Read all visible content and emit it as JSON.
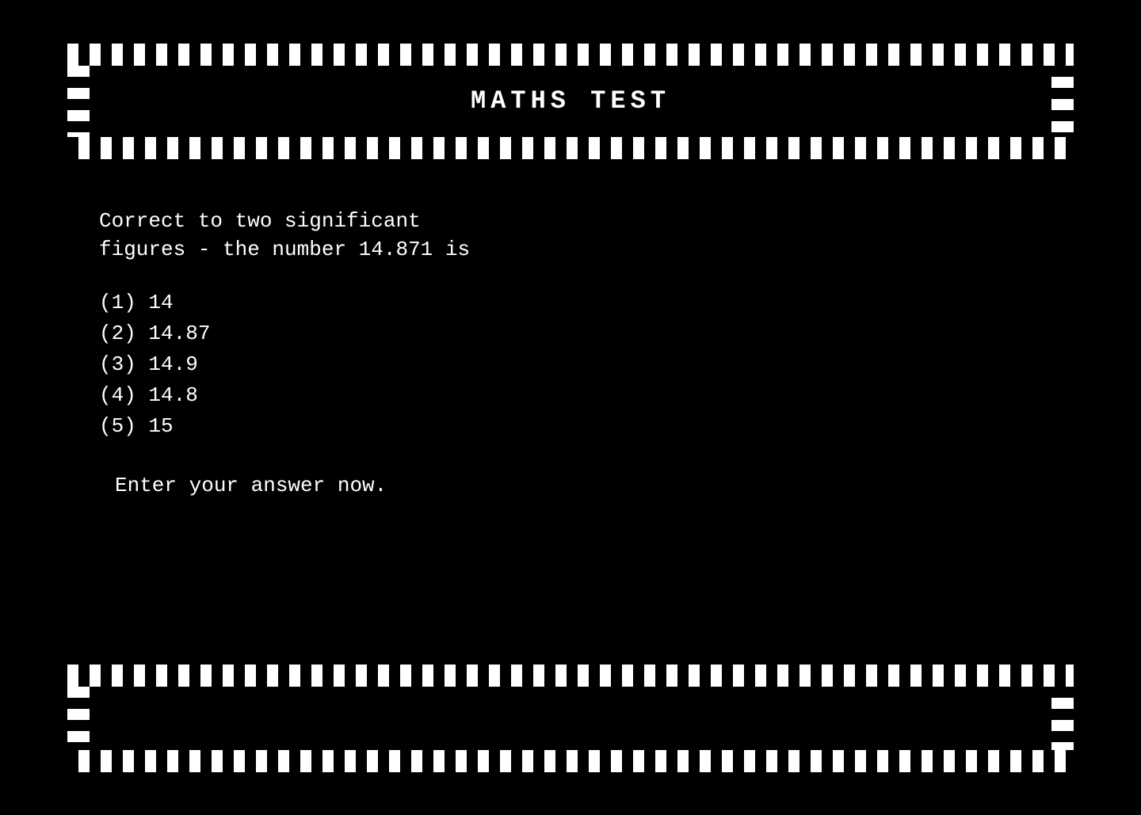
{
  "title": "MATHS TEST",
  "question": {
    "line1": "Correct to two significant",
    "line2": "figures - the number 14.871 is"
  },
  "options": [
    {
      "label": "(1)",
      "value": "14"
    },
    {
      "label": "(2)",
      "value": "14.87"
    },
    {
      "label": "(3)",
      "value": "14.9"
    },
    {
      "label": "(4)",
      "value": "14.8"
    },
    {
      "label": "(5)",
      "value": "15"
    }
  ],
  "prompt": "Enter your answer now.",
  "answer_placeholder": ""
}
